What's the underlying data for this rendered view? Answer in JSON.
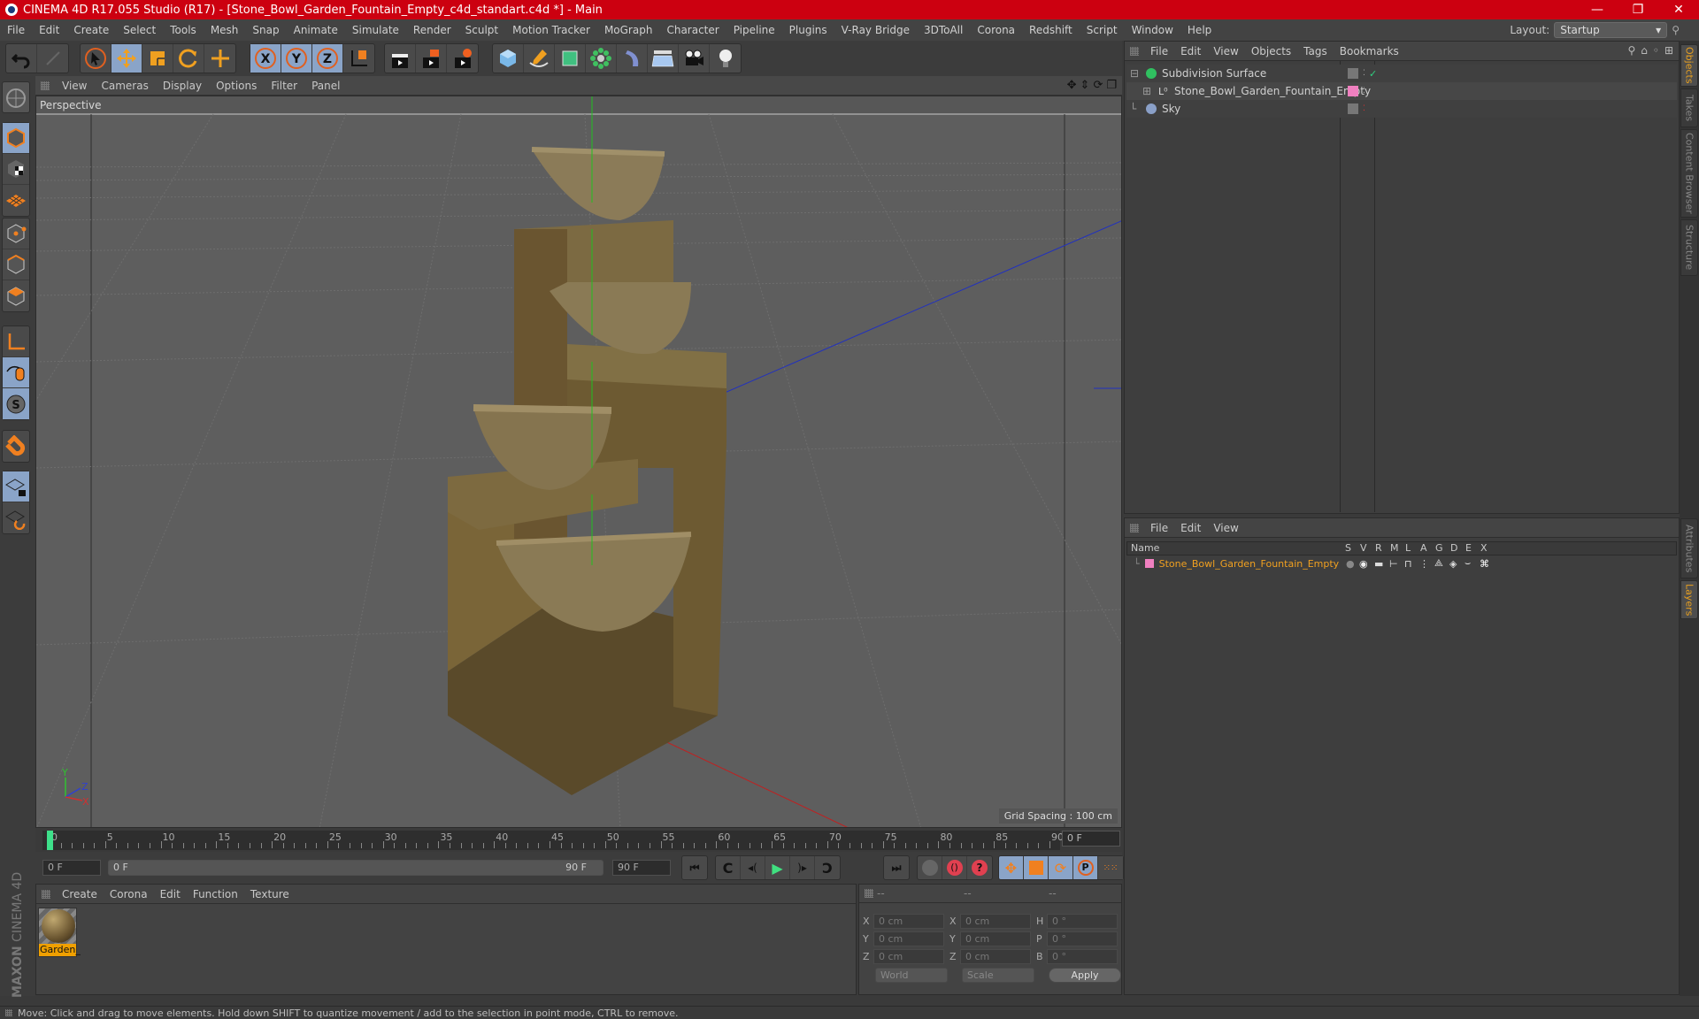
{
  "window": {
    "title": "CINEMA 4D R17.055 Studio (R17) - [Stone_Bowl_Garden_Fountain_Empty_c4d_standart.c4d *] - Main",
    "controls": [
      "minimize",
      "restore",
      "close"
    ]
  },
  "menubar": {
    "items": [
      "File",
      "Edit",
      "Create",
      "Select",
      "Tools",
      "Mesh",
      "Snap",
      "Animate",
      "Simulate",
      "Render",
      "Sculpt",
      "Motion Tracker",
      "MoGraph",
      "Character",
      "Pipeline",
      "Plugins",
      "V-Ray Bridge",
      "3DToAll",
      "Corona",
      "Redshift",
      "Script",
      "Window",
      "Help"
    ],
    "layout_label": "Layout:",
    "layout_value": "Startup"
  },
  "toolbar": {
    "groups": [
      [
        "undo-icon",
        "redo-icon"
      ],
      [
        "select-pointer-icon",
        "move-icon",
        "scale-icon",
        "rotate-icon",
        "last-tool-icon"
      ],
      [
        "x-axis-lock-icon",
        "y-axis-lock-icon",
        "z-axis-lock-icon",
        "world-coordinates-icon"
      ],
      [
        "render-view-icon",
        "render-picture-viewer-icon",
        "render-settings-icon"
      ],
      [
        "cube-icon",
        "pen-spline-icon",
        "subdivision-icon",
        "array-cloner-icon",
        "deformer-icon",
        "floor-icon",
        "camera-icon",
        "light-icon"
      ]
    ]
  },
  "left_toolbar": {
    "items": [
      "make-editable-icon",
      "model-mode-icon",
      "texture-mode-icon",
      "workplane-icon",
      "points-mode-icon",
      "edges-mode-icon",
      "polygons-mode-icon",
      "axis-mode-icon",
      "tweak-mode-icon",
      "solo-icon",
      "snap-magnet-icon",
      "lock-workplane-icon",
      "workplane-rotate-icon"
    ]
  },
  "viewport": {
    "menu": [
      "View",
      "Cameras",
      "Display",
      "Options",
      "Filter",
      "Panel"
    ],
    "camera_label": "Perspective",
    "grid_spacing": "Grid Spacing : 100 cm",
    "nav_icons": [
      "pan-icon",
      "dolly-icon",
      "orbit-icon",
      "maximize-view-icon"
    ],
    "axis_labels": {
      "y": "Y",
      "z": "Z",
      "x": "X"
    }
  },
  "timeline": {
    "ticks": [
      "0",
      "5",
      "10",
      "15",
      "20",
      "25",
      "30",
      "35",
      "40",
      "45",
      "50",
      "55",
      "60",
      "65",
      "70",
      "75",
      "80",
      "85",
      "90"
    ],
    "current_frame": "0 F",
    "start_field": "0 F",
    "range_start": "0 F",
    "range_end": "90 F",
    "end_field": "90 F",
    "playhead_fraction": 0.0
  },
  "transport": {
    "buttons": [
      "go-to-start",
      "go-to-previous-key",
      "previous-frame",
      "play",
      "next-frame",
      "go-to-next-key",
      "go-to-end"
    ],
    "record_buttons": [
      "motion-record",
      "autokey",
      "keyframe-selection"
    ],
    "key_buttons": [
      "key-position",
      "key-scale",
      "key-rotation",
      "key-parameter",
      "key-pla",
      "timeline-window"
    ]
  },
  "material_panel": {
    "menu": [
      "Create",
      "Corona",
      "Edit",
      "Function",
      "Texture"
    ],
    "materials": [
      {
        "name": "Garden_"
      }
    ]
  },
  "coordinates": {
    "headers": [
      "--",
      "--",
      "--"
    ],
    "rows": [
      {
        "l1": "X",
        "v1": "0 cm",
        "l2": "X",
        "v2": "0 cm",
        "l3": "H",
        "v3": "0 °"
      },
      {
        "l1": "Y",
        "v1": "0 cm",
        "l2": "Y",
        "v2": "0 cm",
        "l3": "P",
        "v3": "0 °"
      },
      {
        "l1": "Z",
        "v1": "0 cm",
        "l2": "Z",
        "v2": "0 cm",
        "l3": "B",
        "v3": "0 °"
      }
    ],
    "mode_select": "World",
    "size_select": "Scale",
    "apply_label": "Apply"
  },
  "object_manager": {
    "menu": [
      "File",
      "Edit",
      "View",
      "Objects",
      "Tags",
      "Bookmarks"
    ],
    "objects": [
      {
        "name": "Subdivision Surface",
        "icon": "subdivision-icon",
        "indent": 0,
        "tag": "none",
        "check": "✓"
      },
      {
        "name": "Stone_Bowl_Garden_Fountain_Empty",
        "icon": "null-object-icon",
        "indent": 1,
        "tag": "#f080c0",
        "check": ""
      },
      {
        "name": "Sky",
        "icon": "sky-icon",
        "indent": 0,
        "tag": "none",
        "check": ""
      }
    ]
  },
  "layer_manager": {
    "menu": [
      "File",
      "Edit",
      "View"
    ],
    "columns": [
      "Name",
      "S",
      "V",
      "R",
      "M",
      "L",
      "A",
      "G",
      "D",
      "E",
      "X"
    ],
    "layers": [
      {
        "name": "Stone_Bowl_Garden_Fountain_Empty",
        "color": "#f080c0"
      }
    ]
  },
  "side_tabs": {
    "top": [
      {
        "label": "Objects",
        "active": true
      },
      {
        "label": "Takes",
        "active": false
      },
      {
        "label": "Content Browser",
        "active": false
      },
      {
        "label": "Structure",
        "active": false
      }
    ],
    "bottom": [
      {
        "label": "Attributes",
        "active": false
      },
      {
        "label": "Layers",
        "active": true
      }
    ]
  },
  "status": {
    "text": "Move: Click and drag to move elements. Hold down SHIFT to quantize movement / add to the selection in point mode, CTRL to remove."
  },
  "branding": {
    "maxon": "MAXON",
    "product": "CINEMA 4D"
  },
  "colors": {
    "accent": "#e8a020",
    "titlebar": "#cc0010",
    "active_button": "#8aa4c8",
    "layer_color": "#f080c0"
  }
}
